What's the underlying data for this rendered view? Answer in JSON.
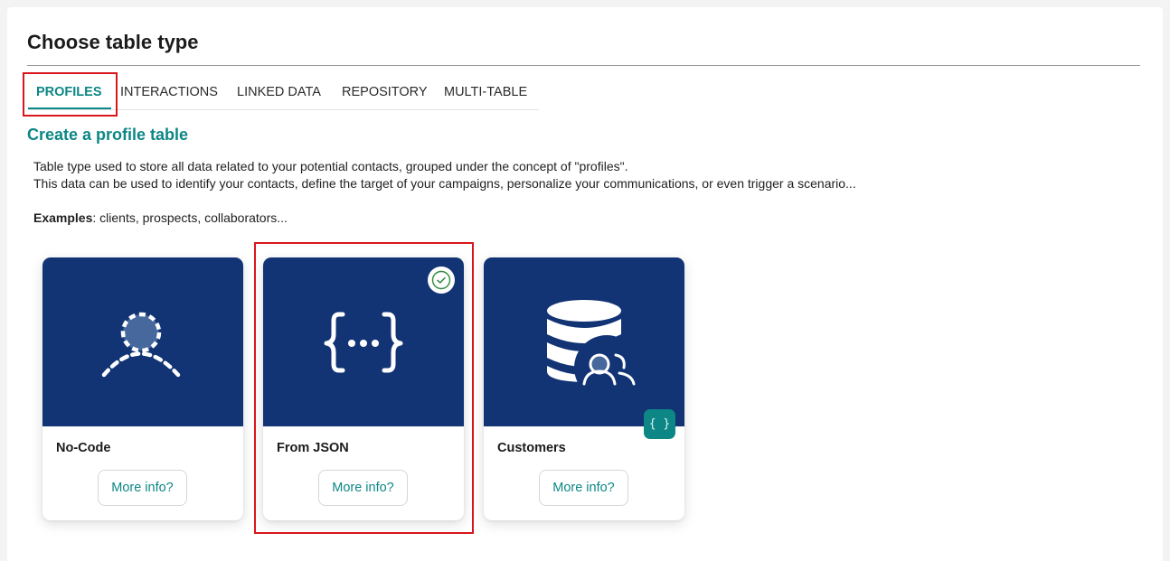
{
  "page": {
    "title": "Choose table type"
  },
  "tabs": [
    {
      "label": "PROFILES",
      "active": true
    },
    {
      "label": "INTERACTIONS",
      "active": false
    },
    {
      "label": "LINKED DATA",
      "active": false
    },
    {
      "label": "REPOSITORY",
      "active": false
    },
    {
      "label": "MULTI-TABLE",
      "active": false
    }
  ],
  "section": {
    "title": "Create a profile table",
    "description_line1": "Table type used to store all data related to your potential contacts, grouped under the concept of \"profiles\".",
    "description_line2": "This data can be used to identify your contacts, define the target of your campaigns, personalize your communications, or even trigger a scenario...",
    "examples_label": "Examples",
    "examples_text": ": clients, prospects, collaborators..."
  },
  "cards": [
    {
      "name": "No-Code",
      "button": "More info?",
      "icon": "user-dashed-icon",
      "selected": false
    },
    {
      "name": "From JSON",
      "button": "More info?",
      "icon": "json-braces-icon",
      "selected": true
    },
    {
      "name": "Customers",
      "button": "More info?",
      "icon": "database-users-icon",
      "selected": false,
      "badge": "{ }"
    }
  ],
  "colors": {
    "accent": "#0d8785",
    "card_header": "#123474",
    "highlight": "#d9161c",
    "selected_check": "#2e8b3e"
  }
}
